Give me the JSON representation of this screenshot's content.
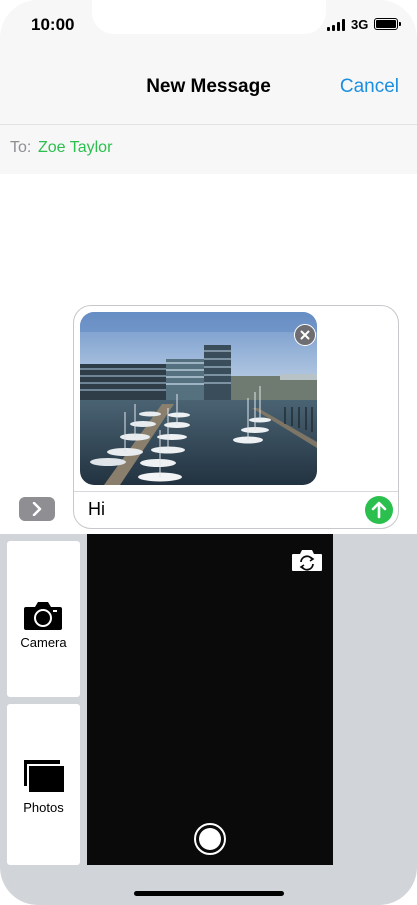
{
  "status_bar": {
    "time": "10:00",
    "network": "3G"
  },
  "nav": {
    "title": "New Message",
    "cancel_label": "Cancel"
  },
  "recipient": {
    "label": "To:",
    "name": "Zoe Taylor"
  },
  "compose": {
    "message_text": "Hi",
    "attachment": "harbour-photo"
  },
  "drawer": {
    "tiles": [
      {
        "label": "Camera",
        "icon": "camera-icon"
      },
      {
        "label": "Photos",
        "icon": "photos-icon"
      }
    ]
  },
  "colors": {
    "accent_blue": "#1a8fe0",
    "accent_green": "#2bbf4e",
    "drawer_bg": "#d1d4d9"
  }
}
